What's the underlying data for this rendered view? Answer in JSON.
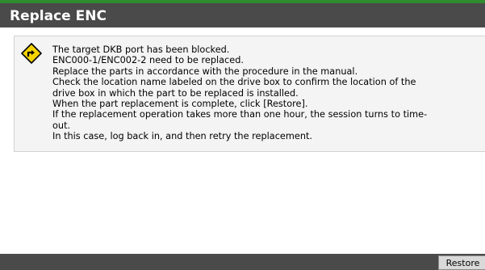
{
  "dialog": {
    "title": "Replace ENC",
    "warning_icon": "warning-diamond-icon",
    "message_lines": [
      "The target DKB port has been blocked.",
      "ENC000-1/ENC002-2 need to be replaced.",
      "Replace the parts in accordance with the procedure in the manual.",
      "Check the location name labeled on the drive box to confirm the location of the",
      "drive box in which the part to be replaced is installed.",
      "When the part replacement is complete, click [Restore].",
      "If the replacement operation takes more than one hour, the session turns to time-",
      "out.",
      "In this case, log back in, and then retry the replacement."
    ]
  },
  "footer": {
    "restore_label": "Restore"
  },
  "colors": {
    "title_bar": "#4a4a4a",
    "title_accent": "#2e8b2e",
    "warning_fill": "#f5d300"
  }
}
